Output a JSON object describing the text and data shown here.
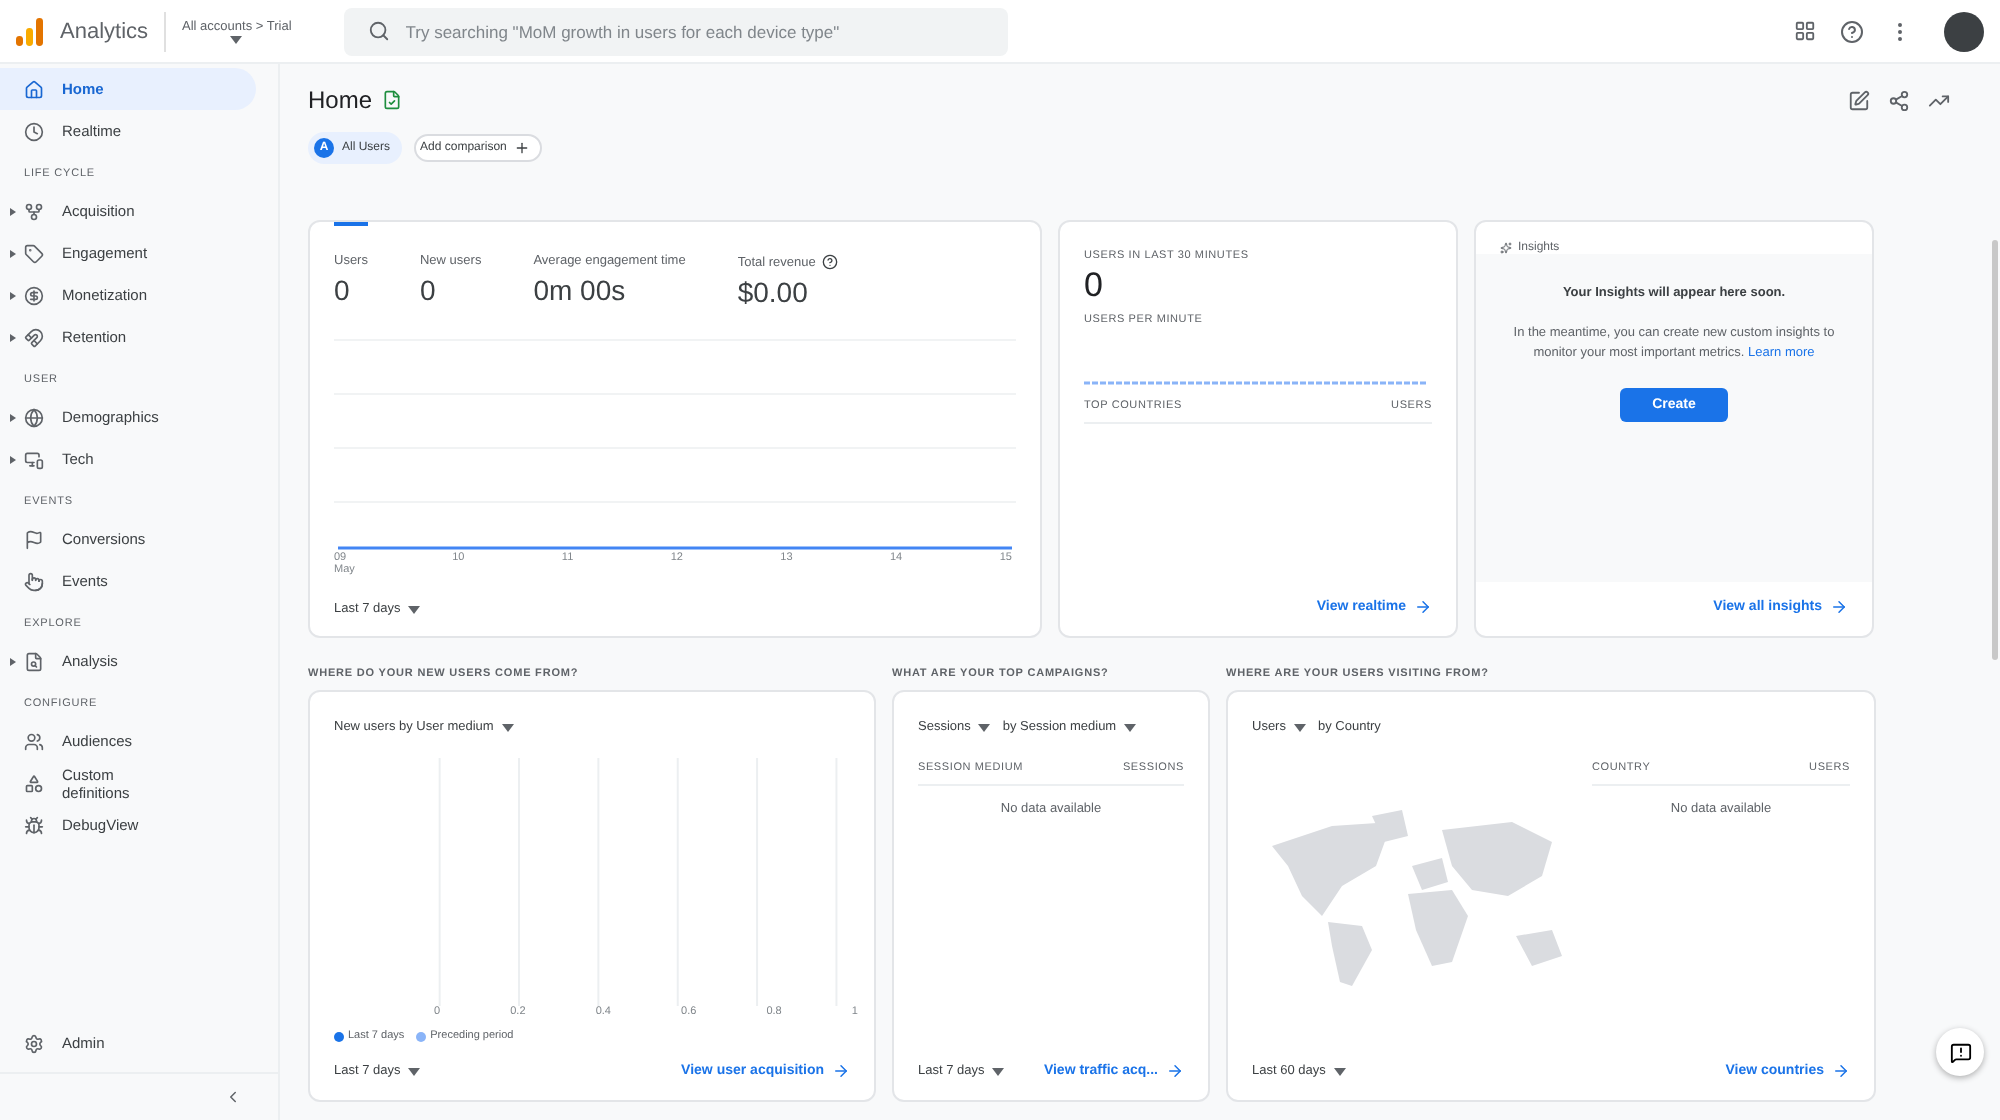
{
  "header": {
    "product": "Analytics",
    "breadcrumb": "All accounts > Trial",
    "search": {
      "placeholder": "Try searching \"MoM growth in users for each device type\""
    }
  },
  "sidebar": {
    "sections": [
      {
        "items": [
          {
            "label": "Home",
            "selected": true,
            "expandable": false
          },
          {
            "label": "Realtime",
            "selected": false,
            "expandable": false
          }
        ]
      },
      {
        "heading": "LIFE CYCLE",
        "items": [
          {
            "label": "Acquisition",
            "selected": false,
            "expandable": true
          },
          {
            "label": "Engagement",
            "selected": false,
            "expandable": true
          },
          {
            "label": "Monetization",
            "selected": false,
            "expandable": true
          },
          {
            "label": "Retention",
            "selected": false,
            "expandable": true
          }
        ]
      },
      {
        "heading": "USER",
        "items": [
          {
            "label": "Demographics",
            "selected": false,
            "expandable": true
          },
          {
            "label": "Tech",
            "selected": false,
            "expandable": true
          }
        ]
      },
      {
        "heading": "EVENTS",
        "items": [
          {
            "label": "Conversions",
            "selected": false,
            "expandable": false
          },
          {
            "label": "Events",
            "selected": false,
            "expandable": false
          }
        ]
      },
      {
        "heading": "EXPLORE",
        "items": [
          {
            "label": "Analysis",
            "selected": false,
            "expandable": true
          }
        ]
      },
      {
        "heading": "CONFIGURE",
        "items": [
          {
            "label": "Audiences",
            "selected": false,
            "expandable": false
          },
          {
            "label": "Custom definitions",
            "selected": false,
            "expandable": false
          },
          {
            "label": "DebugView",
            "selected": false,
            "expandable": false
          }
        ]
      }
    ],
    "footer": {
      "label": "Admin"
    }
  },
  "page": {
    "title": "Home",
    "segment": {
      "avatar": "A",
      "label": "All Users"
    },
    "add_comparison": "Add comparison"
  },
  "overview": {
    "metrics": [
      {
        "label": "Users",
        "value": "0",
        "selected": true,
        "help": false
      },
      {
        "label": "New users",
        "value": "0",
        "selected": false,
        "help": false
      },
      {
        "label": "Average engagement time",
        "value": "0m 00s",
        "selected": false,
        "help": false
      },
      {
        "label": "Total revenue",
        "value": "$0.00",
        "selected": false,
        "help": true
      }
    ],
    "x_labels": [
      [
        "09",
        "May"
      ],
      [
        "10"
      ],
      [
        "11"
      ],
      [
        "12"
      ],
      [
        "13"
      ],
      [
        "14"
      ],
      [
        "15"
      ]
    ],
    "range": "Last 7 days"
  },
  "realtime": {
    "title": "USERS IN LAST 30 MINUTES",
    "value": "0",
    "subtitle": "USERS PER MINUTE",
    "columns": [
      "TOP COUNTRIES",
      "USERS"
    ],
    "link": "View realtime"
  },
  "insights": {
    "title": "Insights",
    "heading": "Your Insights will appear here soon.",
    "body": "In the meantime, you can create new custom insights to monitor your most important metrics.",
    "learn_more": "Learn more",
    "button": "Create",
    "link": "View all insights"
  },
  "acquisition": {
    "heading": "WHERE DO YOUR NEW USERS COME FROM?",
    "selectors": [
      {
        "label": "New users by User medium",
        "dropdown": true
      }
    ],
    "axis": [
      "0",
      "0.2",
      "0.4",
      "0.6",
      "0.8",
      "1"
    ],
    "legend": [
      {
        "label": "Last 7 days",
        "color": "#1a73e8"
      },
      {
        "label": "Preceding period",
        "color": "#8ab4f8"
      }
    ],
    "range": "Last 7 days",
    "link": "View user acquisition"
  },
  "campaigns": {
    "heading": "WHAT ARE YOUR TOP CAMPAIGNS?",
    "selectors": [
      {
        "label": "Sessions",
        "dropdown": true
      },
      {
        "label": "by Session medium",
        "dropdown": true
      }
    ],
    "columns": [
      "SESSION MEDIUM",
      "SESSIONS"
    ],
    "empty": "No data available",
    "range": "Last 7 days",
    "link": "View traffic acq..."
  },
  "countries": {
    "heading": "WHERE ARE YOUR USERS VISITING FROM?",
    "selectors": [
      {
        "label": "Users",
        "dropdown": true
      },
      {
        "label": "by Country",
        "dropdown": false
      }
    ],
    "columns": [
      "COUNTRY",
      "USERS"
    ],
    "empty": "No data available",
    "range": "Last 60 days",
    "link": "View countries"
  }
}
